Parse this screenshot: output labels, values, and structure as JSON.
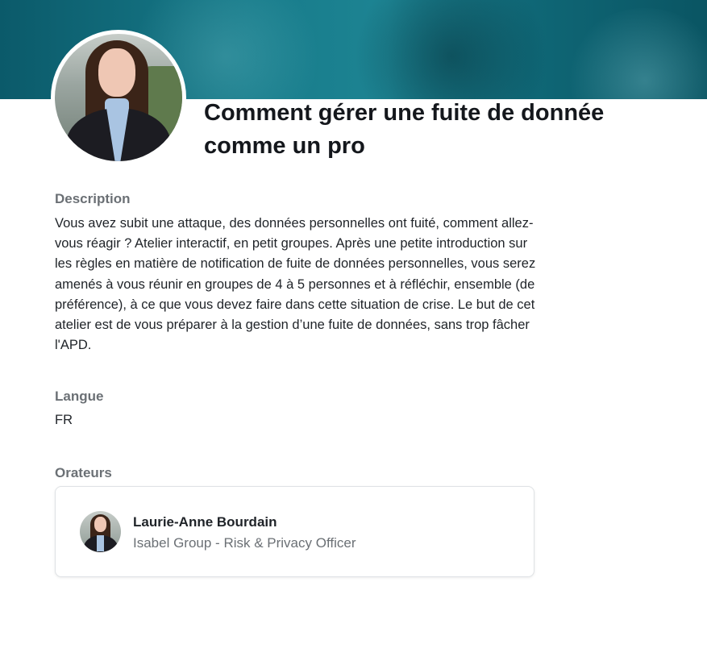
{
  "session": {
    "title": "Comment gérer une fuite de donnée comme un pro"
  },
  "description": {
    "label": "Description",
    "text": "Vous avez subit une attaque, des données personnelles ont fuité, comment allez-vous réagir ? Atelier interactif, en petit groupes. Après une petite introduction sur les règles en matière de notification de fuite de données personnelles, vous serez amenés à vous réunir en groupes de 4 à 5 personnes et à réfléchir, ensemble (de préférence), à ce que vous devez faire dans cette situation de crise. Le but de cet atelier est de vous préparer à la gestion d’une fuite de données, sans trop fâcher l'APD."
  },
  "language": {
    "label": "Langue",
    "value": "FR"
  },
  "speakers": {
    "label": "Orateurs",
    "items": [
      {
        "name": "Laurie-Anne Bourdain",
        "role": "Isabel Group - Risk & Privacy Officer"
      }
    ]
  },
  "colors": {
    "banner": "#177b8a",
    "muted_text": "#6b7075",
    "title_text": "#14171c"
  }
}
